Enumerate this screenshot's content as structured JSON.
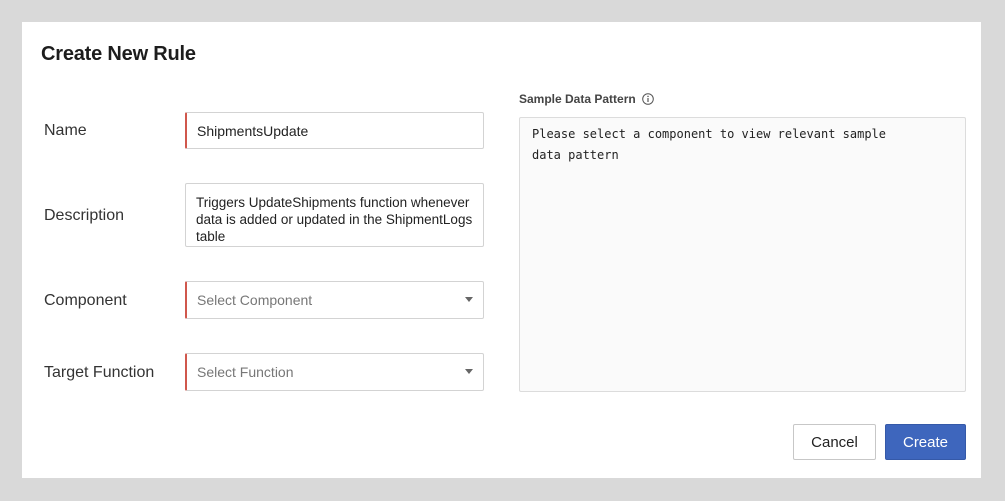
{
  "dialog": {
    "title": "Create New Rule"
  },
  "form": {
    "name": {
      "label": "Name",
      "value": "ShipmentsUpdate"
    },
    "description": {
      "label": "Description",
      "value": "Triggers UpdateShipments function whenever data is added or updated in the ShipmentLogs table"
    },
    "component": {
      "label": "Component",
      "placeholder": "Select Component"
    },
    "target_function": {
      "label": "Target Function",
      "placeholder": "Select Function"
    }
  },
  "sample": {
    "label": "Sample Data Pattern",
    "info_icon": "info-circle-icon",
    "text": "Please select a component to view relevant sample data pattern"
  },
  "actions": {
    "cancel_label": "Cancel",
    "create_label": "Create"
  },
  "colors": {
    "primary": "#3e66bd",
    "required_marker": "#d0574c"
  }
}
